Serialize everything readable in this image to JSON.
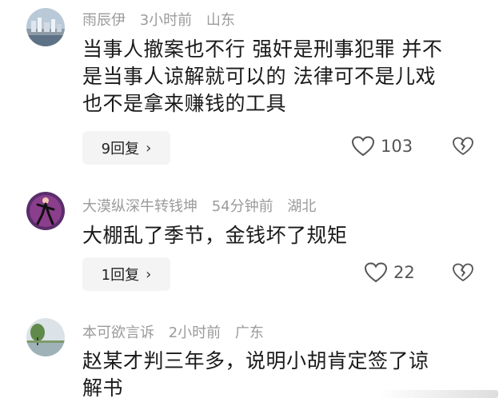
{
  "comments": [
    {
      "username": "雨辰伊",
      "time": "3小时前",
      "location": "山东",
      "lines": [
        "当事人撤案也不行 强奸是刑事犯罪 并不",
        "是当事人谅解就可以的 法律可不是儿戏",
        "也不是拿来赚钱的工具"
      ],
      "reply_label": "9回复",
      "like_count": "103",
      "avatar": "city-skyline-avatar"
    },
    {
      "username": "大漠纵深牛转钱坤",
      "time": "54分钟前",
      "location": "湖北",
      "lines": [
        "大棚乱了季节，金钱坏了规矩"
      ],
      "reply_label": "1回复",
      "like_count": "22",
      "avatar": "dancer-purple-avatar"
    },
    {
      "username": "本可欲言诉",
      "time": "2小时前",
      "location": "广东",
      "lines": [
        "赵某才判三年多，说明小胡肯定签了谅",
        "解书"
      ],
      "avatar": "lake-tree-avatar"
    }
  ],
  "icons": {
    "like": "heart-outline-icon",
    "dislike": "broken-heart-icon",
    "chevron": "chevron-right-icon"
  },
  "colors": {
    "meta_text": "#9b9b9b",
    "body_text": "#1a1a1a",
    "reply_bg": "#f4f4f4"
  }
}
